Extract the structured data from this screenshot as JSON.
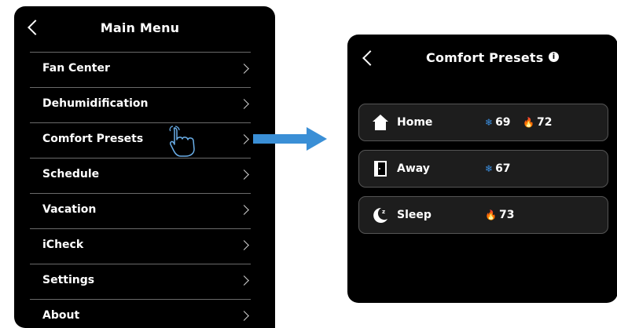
{
  "main_menu": {
    "title": "Main Menu",
    "items": [
      {
        "label": "Fan Center"
      },
      {
        "label": "Dehumidification"
      },
      {
        "label": "Comfort Presets"
      },
      {
        "label": "Schedule"
      },
      {
        "label": "Vacation"
      },
      {
        "label": "iCheck"
      },
      {
        "label": "Settings"
      },
      {
        "label": "About"
      }
    ]
  },
  "comfort_presets": {
    "title": "Comfort Presets",
    "info_icon": "i",
    "presets": [
      {
        "label": "Home",
        "icon": "house-icon",
        "cool": "69",
        "heat": "72"
      },
      {
        "label": "Away",
        "icon": "door-icon",
        "cool": "67",
        "heat": null
      },
      {
        "label": "Sleep",
        "icon": "moon-icon",
        "cool": null,
        "heat": "73"
      }
    ]
  },
  "glyphs": {
    "snowflake": "❄",
    "flame": "🔥"
  },
  "colors": {
    "cool": "#3b8fe0",
    "heat": "#e2462e",
    "arrow": "#3a8fd6",
    "panel": "#000000",
    "card": "#1d1d1d"
  }
}
